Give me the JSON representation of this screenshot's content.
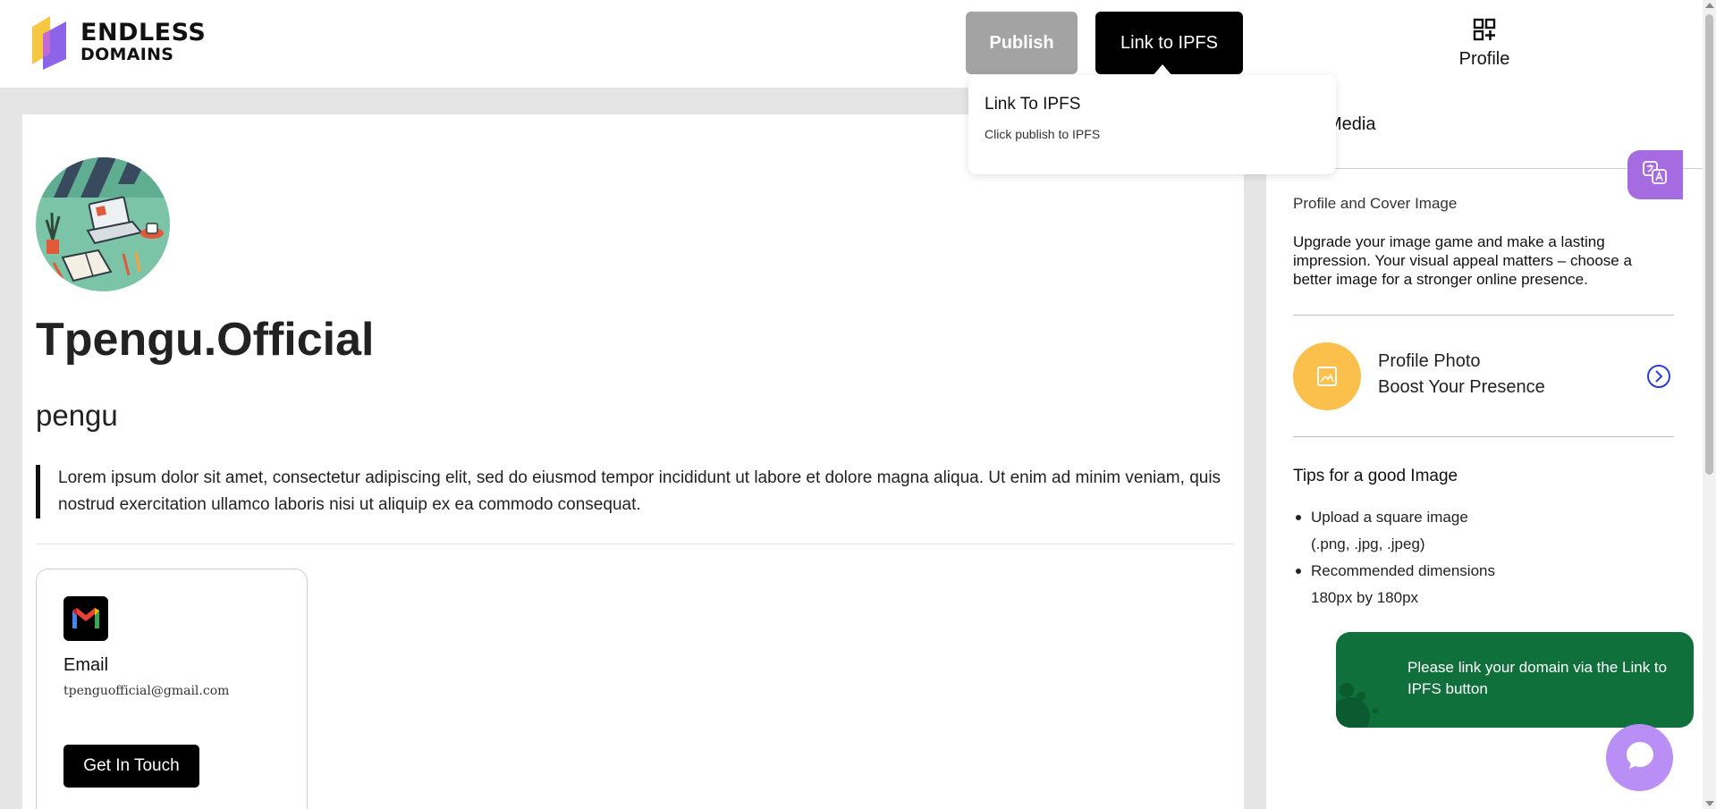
{
  "header": {
    "logo_line1": "ENDLESS",
    "logo_line2": "DOMAINS",
    "publish_label": "Publish",
    "link_ipfs_label": "Link to IPFS",
    "profile_label": "Profile",
    "profile_icon": "grid-plus-icon"
  },
  "tooltip": {
    "title": "Link To IPFS",
    "text": "Click publish to IPFS"
  },
  "profile": {
    "name": "Tpengu.Official",
    "handle": "pengu",
    "bio": "Lorem ipsum dolor sit amet, consectetur adipiscing elit, sed do eiusmod tempor incididunt ut labore et dolore magna aliqua. Ut enim ad minim veniam, quis nostrud exercitation ullamco laboris nisi ut aliquip ex ea commodo consequat."
  },
  "contact_card": {
    "icon": "gmail-icon",
    "title": "Email",
    "email": "tpenguofficial@gmail.com",
    "button_label": "Get In Touch"
  },
  "right_panel": {
    "title": "Media",
    "subtitle": "Profile and Cover Image",
    "description": "Upgrade your image game and make a lasting impression. Your visual appeal matters – choose a better image for a stronger online presence.",
    "photo_line1": "Profile Photo",
    "photo_line2": "Boost Your Presence",
    "tips_title": "Tips for a good Image",
    "tips": [
      {
        "line1": "Upload a square image",
        "line2": "(.png, .jpg, .jpeg)"
      },
      {
        "line1": "Recommended dimensions",
        "line2": "180px by 180px"
      }
    ]
  },
  "toast": {
    "text": "Please link your domain via the Link to IPFS button"
  },
  "colors": {
    "accent_purple": "#a56be0",
    "chat_purple": "#b98ff5",
    "toast_green": "#10703c",
    "photo_yellow": "#fbbf4b",
    "chevron_blue": "#2a3fd6",
    "publish_gray": "#a3a3a3"
  }
}
